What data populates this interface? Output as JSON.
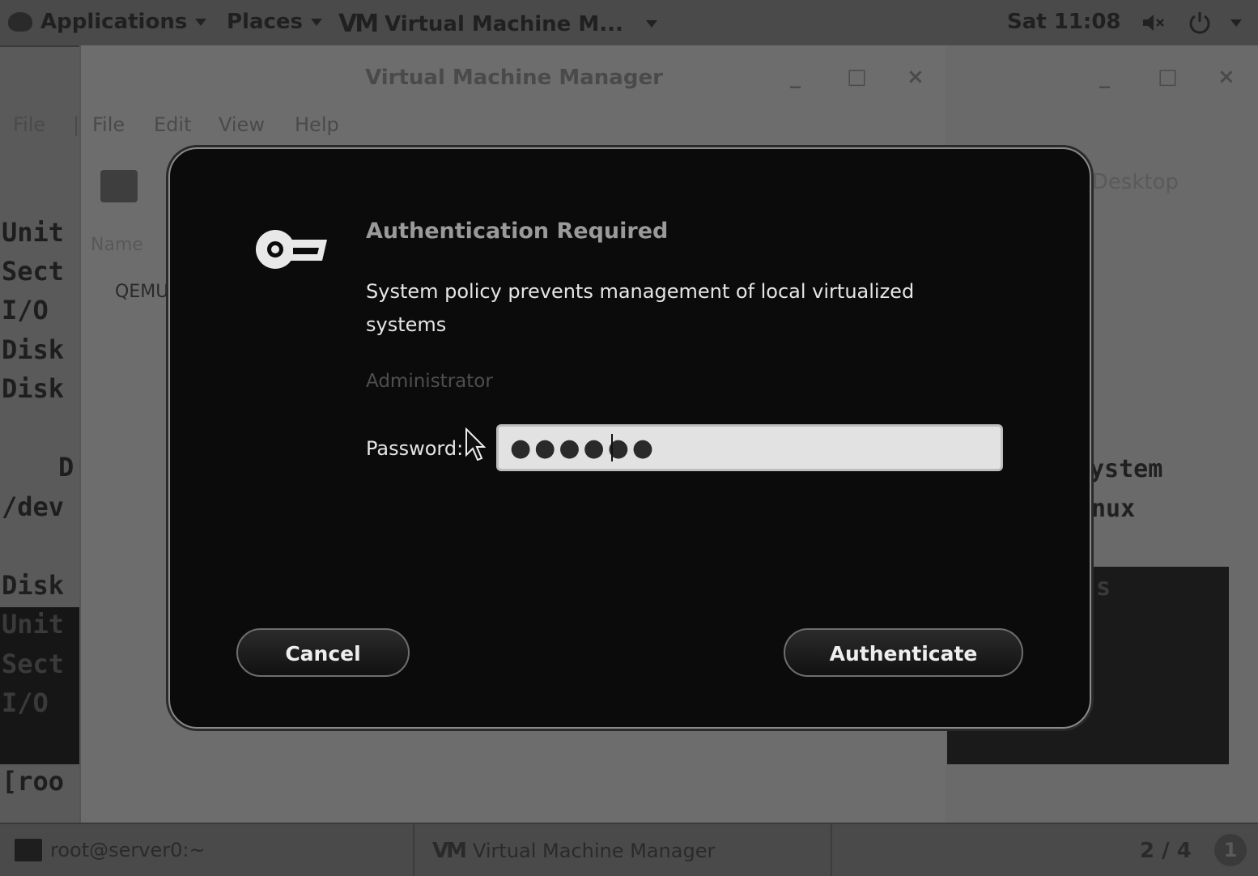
{
  "topbar": {
    "applications": "Applications",
    "places": "Places",
    "active_window": "Virtual Machine M...",
    "clock": "Sat 11:08"
  },
  "vmm": {
    "title": "Virtual Machine Manager",
    "minimize": "_",
    "maximize": "□",
    "close": "×",
    "menu": [
      "File",
      "|",
      "File",
      "Edit",
      "View",
      "Help"
    ],
    "column_name": "Name",
    "connection": "QEMU"
  },
  "right_window": {
    "minimize": "_",
    "maximize": "□",
    "close": "×",
    "path": "/Desktop",
    "lines": [
      "ystem",
      "nux",
      "s"
    ]
  },
  "terminal_lines": [
    "Unit",
    "Sect",
    "I/O",
    "Disk",
    "Disk",
    "D",
    "/dev",
    "Disk",
    "Unit",
    "Sect",
    "I/O",
    "[roo"
  ],
  "dialog": {
    "title": "Authentication Required",
    "message": "System policy prevents management of local virtualized systems",
    "user": "Administrator",
    "password_label": "Password:",
    "password_value": "●●●●●●",
    "cancel": "Cancel",
    "authenticate": "Authenticate"
  },
  "taskbar": {
    "terminal_task": "root@server0:~",
    "vmm_task": "Virtual Machine Manager",
    "workspace": "2 / 4",
    "notification": "1"
  }
}
